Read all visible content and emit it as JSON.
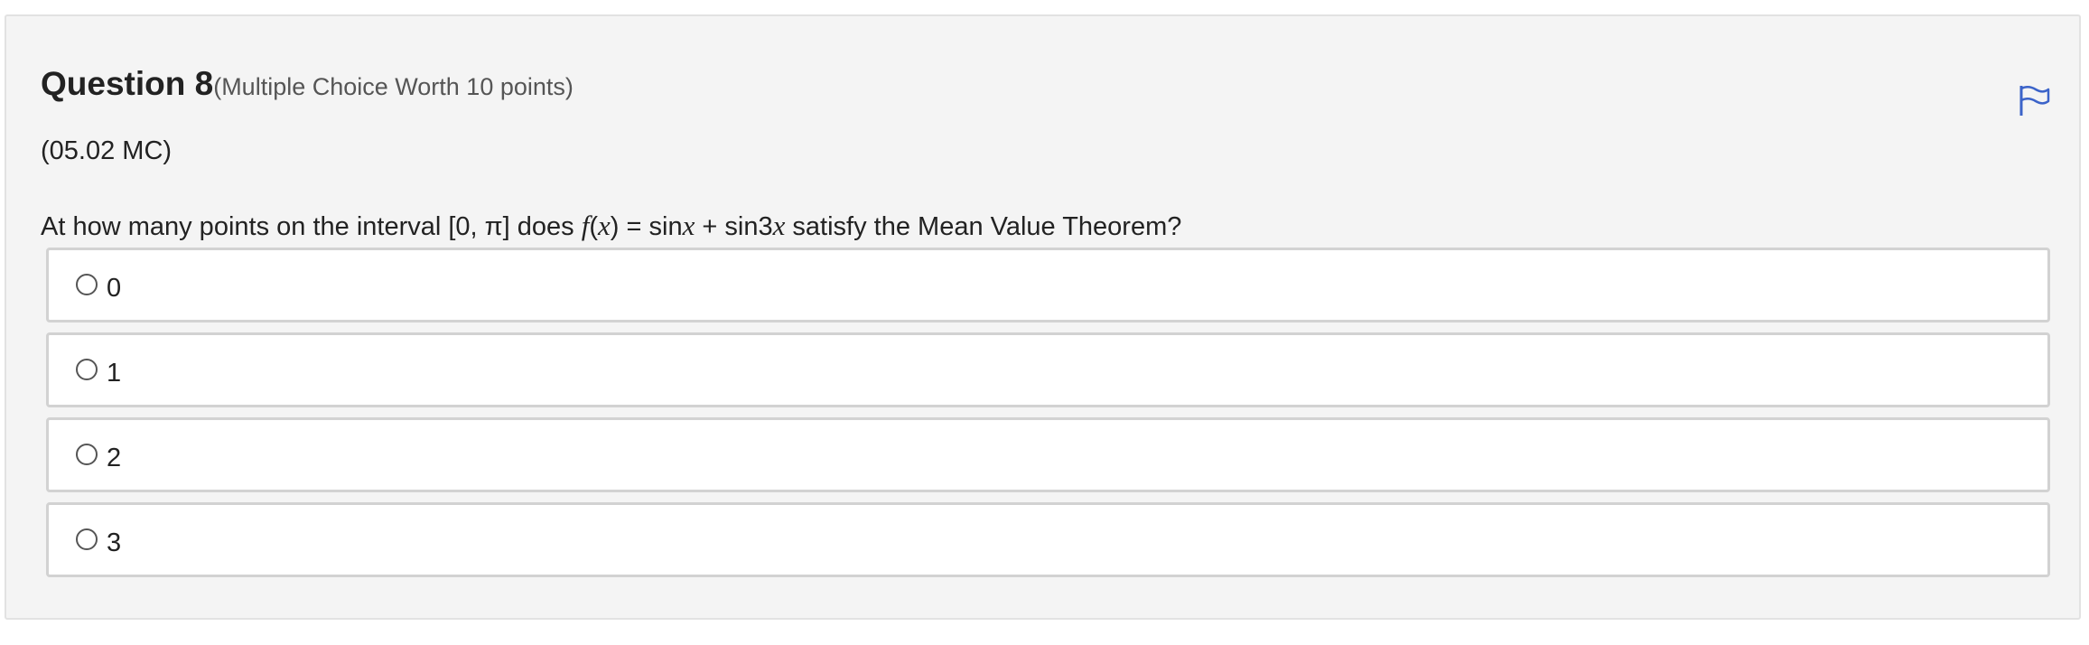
{
  "question": {
    "title": "Question 8",
    "worth": "(Multiple Choice Worth 10 points)",
    "code": "(05.02 MC)",
    "prompt": {
      "part1": "At how many points on the interval [0, π] does ",
      "fx": "f",
      "paren_open": "(",
      "x1": "x",
      "paren_close": ")",
      "part2": " = sin",
      "x2": "x",
      "part3": " + sin3",
      "x3": "x",
      "part4": " satisfy the Mean Value Theorem?"
    },
    "flag_icon": "flag-icon",
    "choices": [
      {
        "label": "0"
      },
      {
        "label": "1"
      },
      {
        "label": "2"
      },
      {
        "label": "3"
      }
    ]
  },
  "colors": {
    "card_background": "#f4f4f4",
    "card_border": "#e2e2e2",
    "choice_border": "#d2d2d2",
    "flag": "#3b63c9"
  }
}
